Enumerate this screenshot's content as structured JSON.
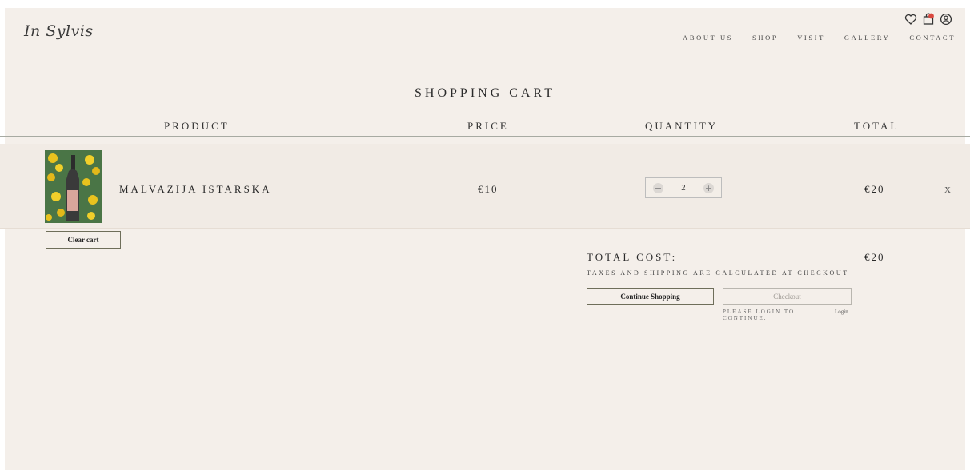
{
  "brand": {
    "logo_text": "In Sylvis"
  },
  "nav": {
    "items": [
      "ABOUT US",
      "SHOP",
      "VISIT",
      "GALLERY",
      "CONTACT"
    ],
    "icons": [
      "heart-icon",
      "shopping-bag-icon",
      "user-circle-icon"
    ],
    "cart_badge_color": "#d9473e"
  },
  "cart": {
    "title": "SHOPPING CART",
    "columns": [
      "PRODUCT",
      "PRICE",
      "QUANTITY",
      "TOTAL"
    ],
    "items": [
      {
        "name": "MALVAZIJA ISTARSKA",
        "price": "€10",
        "quantity": "2",
        "total": "€20",
        "remove_label": "X",
        "qty_minus": "−",
        "qty_plus": "+"
      }
    ],
    "clear_cart_label": "Clear cart"
  },
  "summary": {
    "total_cost_label": "TOTAL COST:",
    "total_cost_value": "€20",
    "taxes_note": "TAXES AND SHIPPING ARE CALCULATED AT CHECKOUT",
    "continue_label": "Continue Shopping",
    "checkout_label": "Checkout",
    "login_note": "PLEASE LOGIN TO CONTINUE.",
    "login_link": "Login"
  },
  "colors": {
    "background": "#f4efea",
    "divider": "#a7aaa2",
    "button_border": "#6e6e5a"
  }
}
